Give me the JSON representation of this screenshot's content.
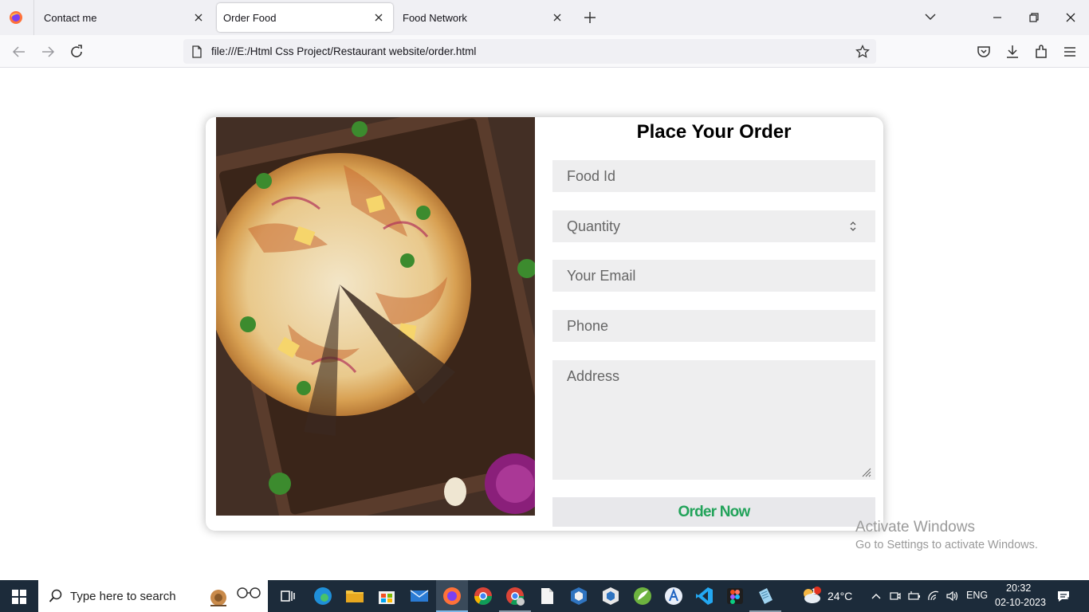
{
  "browser": {
    "tabs": [
      {
        "label": "Contact me"
      },
      {
        "label": "Order Food",
        "active": true
      },
      {
        "label": "Food Network"
      }
    ],
    "url": "file:///E:/Html Css Project/Restaurant website/order.html"
  },
  "page": {
    "title": "Place Your Order",
    "fields": {
      "food_id_placeholder": "Food Id",
      "quantity_placeholder": "Quantity",
      "email_placeholder": "Your Email",
      "phone_placeholder": "Phone",
      "address_placeholder": "Address"
    },
    "button_label": "Order Now",
    "accent_color": "#22a35a"
  },
  "watermark": {
    "line1": "Activate Windows",
    "line2": "Go to Settings to activate Windows."
  },
  "taskbar": {
    "search_placeholder": "Type here to search",
    "weather": "24°C",
    "language": "ENG",
    "time": "20:32",
    "date": "02-10-2023",
    "notification_count": "1",
    "weather_badge": "1"
  }
}
